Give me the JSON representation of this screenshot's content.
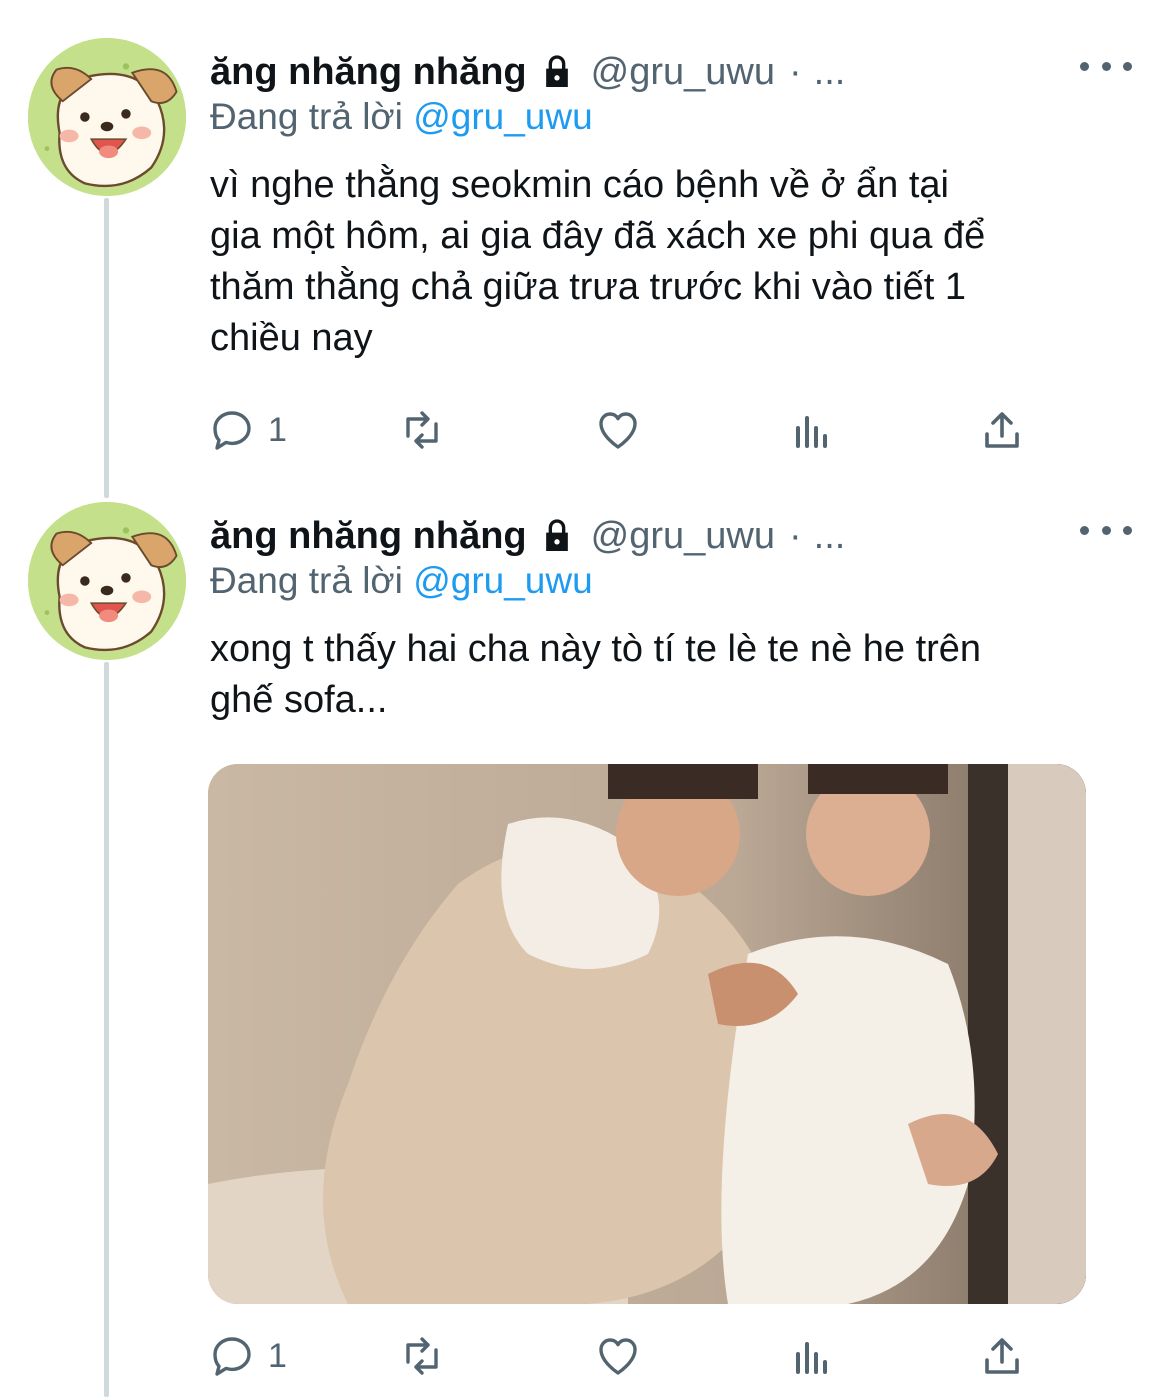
{
  "tweets": [
    {
      "author_name": "ăng nhăng nhăng",
      "protected_icon": "lock-icon",
      "handle": "@gru_uwu",
      "separator": "·",
      "time_truncated": "...",
      "replying_prefix": "Đang trả lời",
      "replying_to": "@gru_uwu",
      "text": "vì nghe thằng seokmin cáo bệnh về ở ẩn tại\ngia một hôm, ai gia đây đã xách xe phi qua để\nthăm thằng chả giữa trưa trước khi vào tiết 1\nchiều nay",
      "reply_count": "1",
      "has_media": false
    },
    {
      "author_name": "ăng nhăng nhăng",
      "protected_icon": "lock-icon",
      "handle": "@gru_uwu",
      "separator": "·",
      "time_truncated": "...",
      "replying_prefix": "Đang trả lời",
      "replying_to": "@gru_uwu",
      "text": "xong t thấy hai cha này tò tí te lè te nè he trên\nghế sofa...",
      "reply_count": "1",
      "has_media": true
    }
  ],
  "icons": {
    "reply": "reply-icon",
    "retweet": "retweet-icon",
    "like": "heart-icon",
    "analytics": "analytics-icon",
    "share": "share-icon",
    "more": "more-icon"
  },
  "colors": {
    "text": "#0f1419",
    "secondary": "#536471",
    "accent": "#1d9bf0",
    "thread_line": "#cfd9de"
  }
}
